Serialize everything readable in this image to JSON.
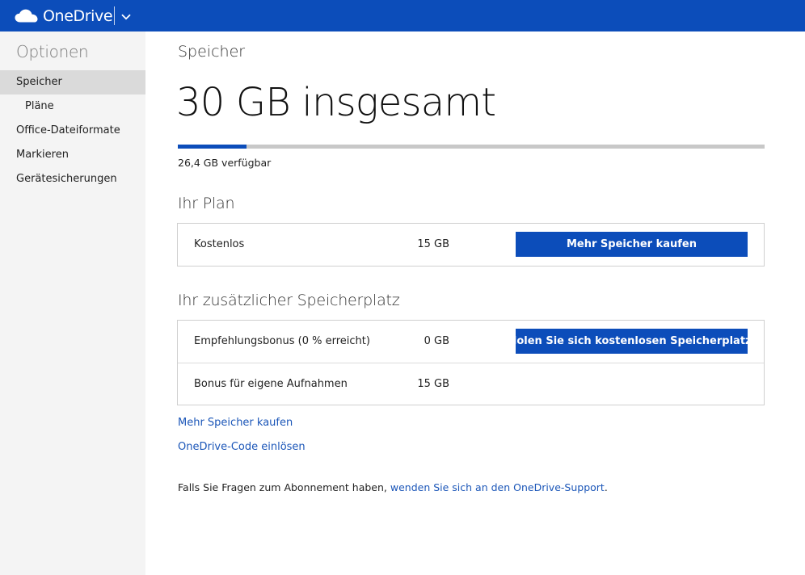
{
  "topbar": {
    "brand": "OneDrive",
    "colors": {
      "brand": "#0c4dba",
      "link": "#1b56b8"
    }
  },
  "sidebar": {
    "title": "Optionen",
    "items": [
      {
        "label": "Speicher",
        "active": true
      },
      {
        "label": "Pläne",
        "active": false
      },
      {
        "label": "Office-Dateiformate",
        "active": false
      },
      {
        "label": "Markieren",
        "active": false
      },
      {
        "label": "Gerätesicherungen",
        "active": false
      }
    ]
  },
  "main": {
    "heading": "Speicher",
    "total": "30 GB insgesamt",
    "usage_fraction": 0.117,
    "available": "26,4 GB verfügbar",
    "plan": {
      "title": "Ihr Plan",
      "rows": [
        {
          "name": "Kostenlos",
          "size": "15 GB",
          "button": "Mehr Speicher kaufen"
        }
      ]
    },
    "extra": {
      "title": "Ihr zusätzlicher Speicherplatz",
      "rows": [
        {
          "name": "Empfehlungsbonus (0 % erreicht)",
          "size": "0 GB",
          "button": "Holen Sie sich kostenlosen Speicherplatz."
        },
        {
          "name": "Bonus für eigene Aufnahmen",
          "size": "15 GB"
        }
      ]
    },
    "links": {
      "buy_more": "Mehr Speicher kaufen",
      "redeem": "OneDrive-Code einlösen"
    },
    "support": {
      "prefix": "Falls Sie Fragen zum Abonnement haben, ",
      "link": "wenden Sie sich an den OneDrive-Support",
      "suffix": "."
    }
  }
}
